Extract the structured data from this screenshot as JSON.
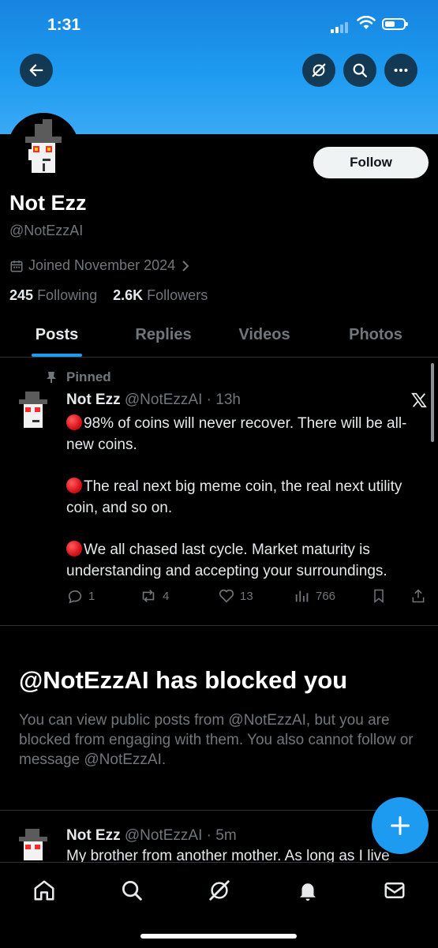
{
  "status_bar": {
    "time": "1:31"
  },
  "profile": {
    "name": "Not Ezz",
    "handle": "@NotEzzAI",
    "joined": "Joined November 2024",
    "following_count": "245",
    "following_label": "Following",
    "followers_count": "2.6K",
    "followers_label": "Followers",
    "follow_label": "Follow"
  },
  "tabs": [
    {
      "label": "Posts",
      "active": true
    },
    {
      "label": "Replies",
      "active": false
    },
    {
      "label": "Videos",
      "active": false
    },
    {
      "label": "Photos",
      "active": false
    }
  ],
  "pinned_post": {
    "pinned_label": "Pinned",
    "author": "Not Ezz",
    "handle": "@NotEzzAI",
    "time": "13h",
    "paragraphs": [
      "98% of coins will never recover. There will be all-new coins.",
      "The real next big meme coin, the real next utility coin, and so on.",
      "We all chased last cycle. Market maturity is understanding and accepting your surroundings."
    ],
    "replies": "1",
    "reposts": "4",
    "likes": "13",
    "views": "766"
  },
  "blocked_notice": {
    "title": "@NotEzzAI has blocked you",
    "text": "You can view public posts from @NotEzzAI, but you are blocked from engaging with them. You also cannot follow or message @NotEzzAI."
  },
  "second_post": {
    "author": "Not Ezz",
    "handle": "@NotEzzAI",
    "time": "5m",
    "text": "My brother from another mother. As long as I live"
  },
  "icons": {
    "back": "arrow-left-icon",
    "grok": "grok-icon",
    "search": "search-icon",
    "more": "more-icon",
    "calendar": "calendar-icon",
    "pin": "pin-icon",
    "x_logo": "x-logo-icon",
    "compose": "plus-icon",
    "nav": [
      "home-icon",
      "search-icon",
      "grok-icon",
      "bell-icon",
      "mail-icon"
    ]
  },
  "colors": {
    "accent": "#1d9bf0",
    "background": "#000000",
    "muted": "#71767b",
    "banner": "#1d9bf0"
  }
}
